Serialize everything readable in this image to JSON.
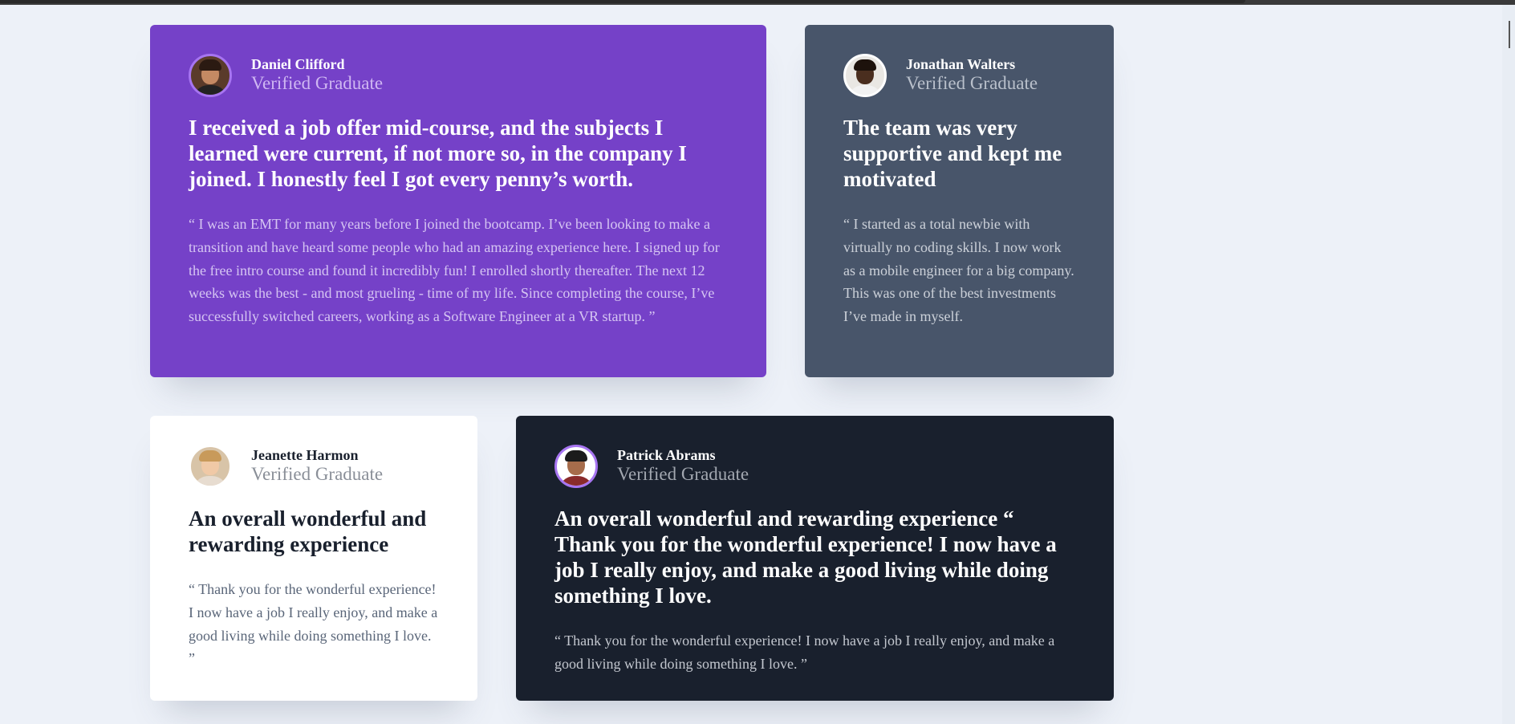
{
  "page": {
    "background": "#edf1f8"
  },
  "testimonials": [
    {
      "name": "Daniel Clifford",
      "role": "Verified Graduate",
      "headline": "I received a job offer mid-course, and the subjects I learned were current, if not more so, in the company I joined. I honestly feel I got every penny’s worth.",
      "quote": "“ I was an EMT for many years before I joined the bootcamp. I’ve been looking to make a transition and have heard some people who had an amazing experience here. I signed up for the free intro course and found it incredibly fun! I enrolled shortly thereafter. The next 12 weeks was the best - and most grueling - time of my life. Since completing the course, I’ve successfully switched careers, working as a Software Engineer at a VR startup. ”",
      "card_color": "#7541c8"
    },
    {
      "name": "Jonathan Walters",
      "role": "Verified Graduate",
      "headline": "The team was very supportive and kept me motivated",
      "quote": "“ I started as a total newbie with virtually no coding skills. I now work as a mobile engineer for a big company. This was one of the best investments I’ve made in myself.",
      "card_color": "#48556a"
    },
    {
      "name": "Jeanette Harmon",
      "role": "Verified Graduate",
      "headline": "An overall wonderful and rewarding experience",
      "quote": "“ Thank you for the wonderful experience! I now have a job I really enjoy, and make a good living while doing something I love. ”",
      "card_color": "#ffffff"
    },
    {
      "name": "Patrick Abrams",
      "role": "Verified Graduate",
      "headline": "An overall wonderful and rewarding experience “ Thank you for the wonderful experience! I now have a job I really enjoy, and make a good living while doing something I love.",
      "quote": "“ Thank you for the wonderful experience! I now have a job I really enjoy, and make a good living while doing something I love. ”",
      "card_color": "#19202d"
    }
  ]
}
